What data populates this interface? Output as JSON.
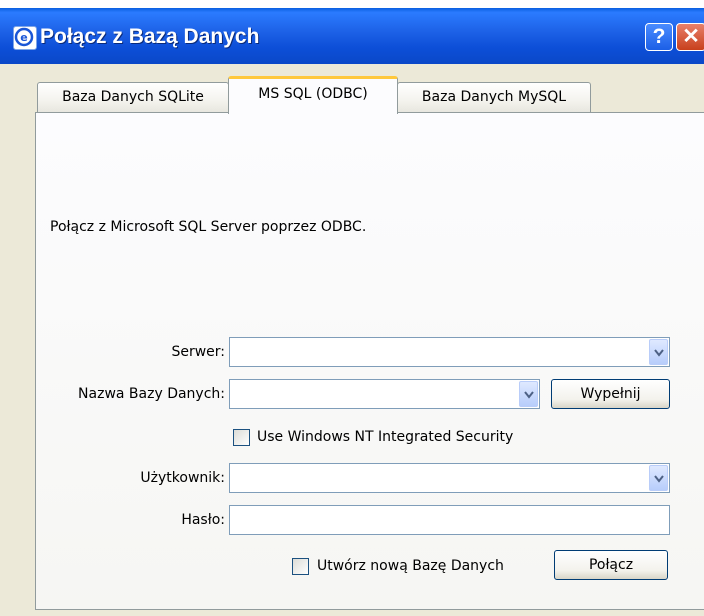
{
  "window": {
    "title": "Połącz z Bazą Danych",
    "help_label": "?",
    "close_label": "✕"
  },
  "tabs": [
    {
      "label": "Baza Danych SQLite",
      "selected": false
    },
    {
      "label": "MS SQL (ODBC)",
      "selected": true
    },
    {
      "label": "Baza Danych MySQL",
      "selected": false
    }
  ],
  "panel": {
    "description": "Połącz z Microsoft SQL Server poprzez ODBC.",
    "server": {
      "label": "Serwer:",
      "value": ""
    },
    "database": {
      "label": "Nazwa Bazy Danych:",
      "value": "",
      "fill_button": "Wypełnij"
    },
    "nt_security": {
      "label": "Use Windows NT Integrated Security",
      "checked": false
    },
    "user": {
      "label": "Użytkownik:",
      "value": ""
    },
    "password": {
      "label": "Hasło:",
      "value": ""
    },
    "create_db": {
      "label": "Utwórz nową Bazę Danych",
      "checked": false
    },
    "connect_button": "Połącz"
  },
  "colors": {
    "titlebar": "#0d4fd8",
    "tab_highlight": "#ffc83c",
    "dialog_bg": "#ece9d8"
  }
}
